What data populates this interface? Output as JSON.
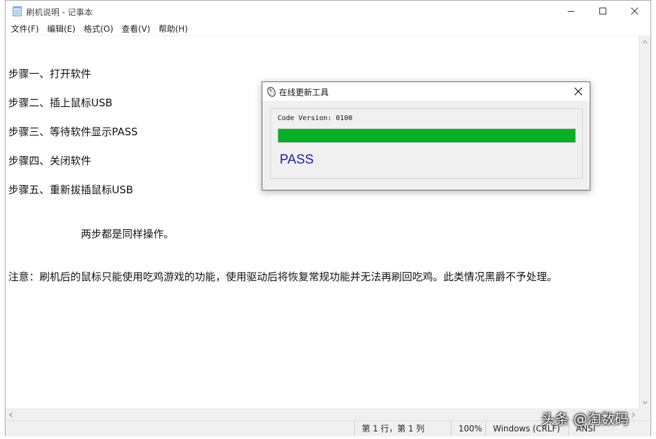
{
  "window": {
    "title": "刷机说明 - 记事本",
    "menu": [
      "文件(F)",
      "编辑(E)",
      "格式(O)",
      "查看(V)",
      "帮助(H)"
    ]
  },
  "editor": {
    "lines": [
      "步骤一、打开软件",
      "步骤二、插上鼠标USB",
      "步骤三、等待软件显示PASS",
      "步骤四、关闭软件",
      "步骤五、重新拔插鼠标USB",
      "两步都是同样操作。",
      "注意：刷机后的鼠标只能使用吃鸡游戏的功能，使用驱动后将恢复常规功能并无法再刷回吃鸡。此类情况黑爵不予处理。"
    ]
  },
  "statusbar": {
    "position": "第 1 行，第 1 列",
    "zoom": "100%",
    "line_ending": "Windows (CRLF)",
    "encoding": "ANSI"
  },
  "dialog": {
    "title": "在线更新工具",
    "code_version": "Code Version: 0100",
    "progress": 1.0,
    "result": "PASS",
    "progress_color": "#06b025",
    "result_color": "#1a1ab5"
  },
  "watermark": "头条 @淘数码",
  "icons": {
    "app": "notepad-icon",
    "dialog": "mouse-icon"
  }
}
